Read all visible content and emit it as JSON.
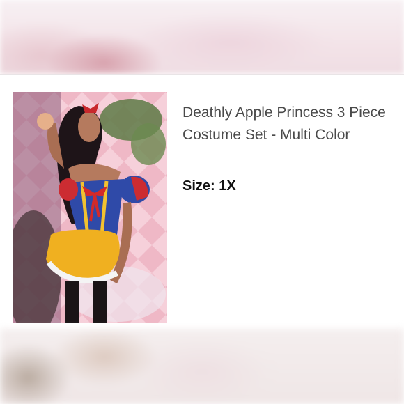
{
  "product": {
    "title": "Deathly Apple Princess 3 Piece Costume Set - Multi Color",
    "size_label": "Size:",
    "size_value": "1X",
    "image_description_icon": "product-photo"
  }
}
